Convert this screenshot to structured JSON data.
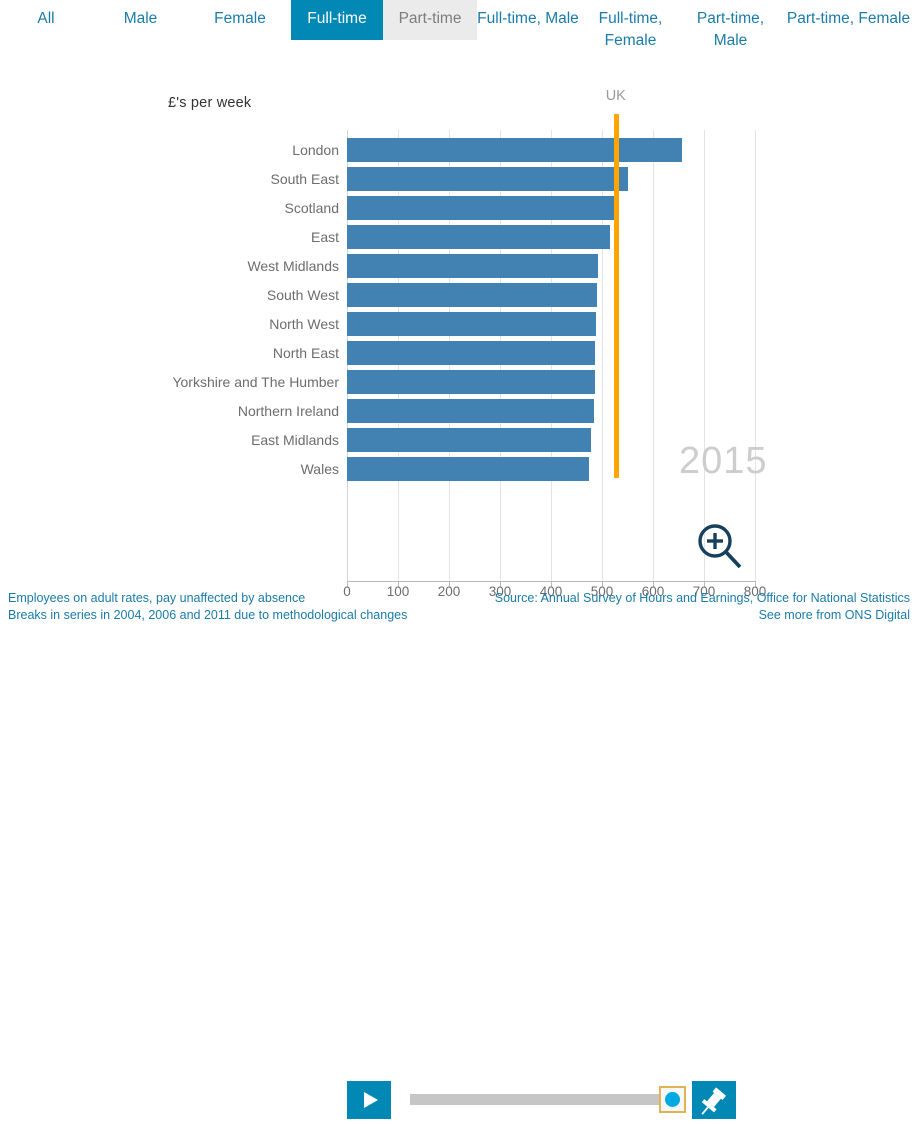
{
  "tabs": [
    {
      "label": "All",
      "state": "normal",
      "width": 92
    },
    {
      "label": "Male",
      "state": "normal",
      "width": 97
    },
    {
      "label": "Female",
      "state": "normal",
      "width": 102
    },
    {
      "label": "Full-time",
      "state": "active",
      "width": 92
    },
    {
      "label": "Part-time",
      "state": "hover",
      "width": 94
    },
    {
      "label": "Full-time, Male",
      "state": "normal",
      "width": 102
    },
    {
      "label": "Full-time, Female",
      "state": "normal",
      "width": 103
    },
    {
      "label": "Part-time, Male",
      "state": "normal",
      "width": 97
    },
    {
      "label": "Part-time, Female",
      "state": "normal",
      "width": 139
    }
  ],
  "chart": {
    "axis_title": "£'s per week",
    "reference_label": "UK",
    "reference_value": 527,
    "year_watermark": "2015",
    "zoom_icon": "magnifier-plus-icon"
  },
  "controls": {
    "play_label": "play-icon",
    "pin_label": "pin-icon",
    "slider_value": 100
  },
  "footer": {
    "note_line1": "Employees on adult rates, pay unaffected by absence",
    "note_line2": "Breaks in series in 2004, 2006 and 2011 due to methodological changes",
    "source_line1": "Source: Annual Survey of Hours and Earnings, Office for National Statistics",
    "source_line2": "See more from ONS Digital"
  },
  "colors": {
    "bar": "#4282b3",
    "accent": "#0288b5",
    "link": "#1a7ca8",
    "reference": "#ffa400",
    "watermark": "#cdcdcd"
  },
  "chart_data": {
    "type": "bar",
    "orientation": "horizontal",
    "title": "",
    "xlabel": "£'s per week",
    "ylabel": "",
    "xlim": [
      0,
      800
    ],
    "xticks": [
      0,
      100,
      200,
      300,
      400,
      500,
      600,
      700,
      800
    ],
    "grid": true,
    "legend": "none",
    "categories": [
      "London",
      "South East",
      "Scotland",
      "East",
      "West Midlands",
      "South West",
      "North West",
      "North East",
      "Yorkshire and The Humber",
      "Northern Ireland",
      "East Midlands",
      "Wales"
    ],
    "values": [
      657,
      551,
      526,
      516,
      492,
      491,
      488,
      487,
      486,
      484,
      478,
      474
    ],
    "annotations": [
      {
        "label": "UK",
        "value": 527,
        "type": "reference-line",
        "color": "#ffa400"
      },
      {
        "label": "2015",
        "type": "year-watermark"
      }
    ]
  }
}
